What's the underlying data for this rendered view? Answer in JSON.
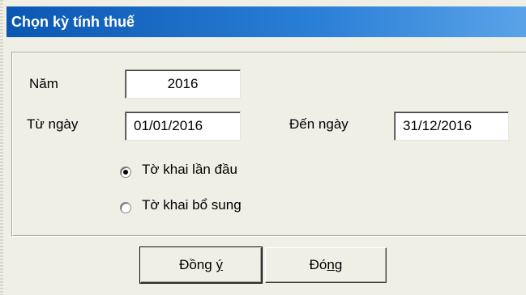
{
  "window": {
    "title": "Chọn kỳ tính thuế"
  },
  "form": {
    "year_label": "Năm",
    "year_value": "2016",
    "from_label": "Từ ngày",
    "from_value": "01/01/2016",
    "to_label": "Đến ngày",
    "to_value": "31/12/2016"
  },
  "declaration_type": {
    "options": [
      {
        "label": "Tờ khai lần đầu",
        "selected": true
      },
      {
        "label": "Tờ khai bổ sung",
        "selected": false
      }
    ]
  },
  "buttons": {
    "ok_pre": "Đồng ",
    "ok_mnemonic": "ý",
    "close_pre": "Đó",
    "close_mnemonic": "n",
    "close_post": "g"
  },
  "colors": {
    "title_bar": "#0a57b3",
    "title_text": "#ffffff",
    "background": "#f0efe6"
  }
}
